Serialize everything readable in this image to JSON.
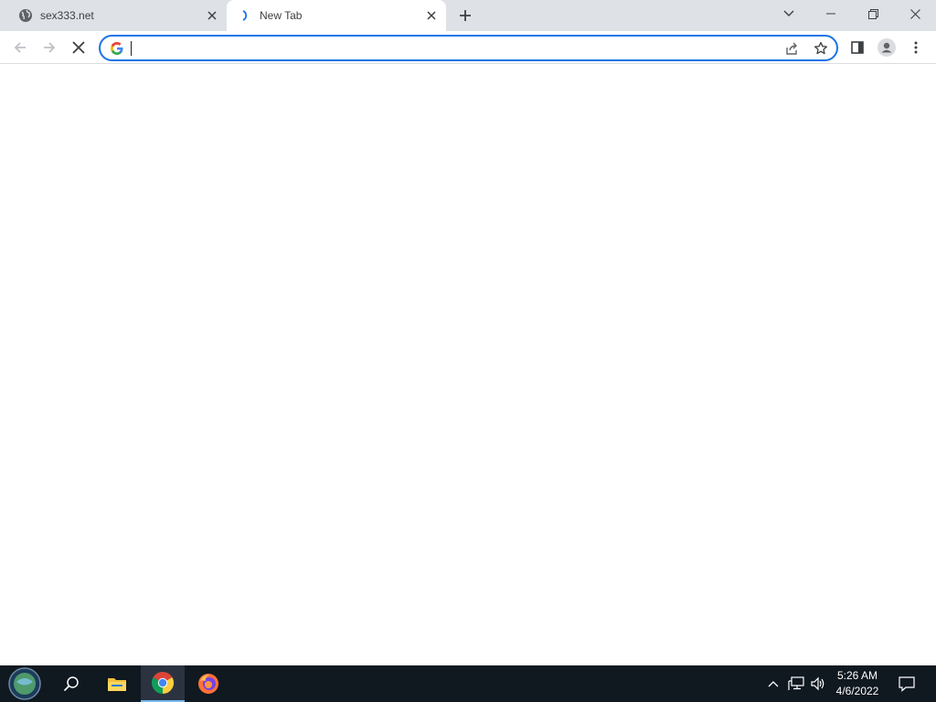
{
  "tabs": [
    {
      "title": "sex333.net",
      "favicon": "globe-icon",
      "active": false
    },
    {
      "title": "New Tab",
      "favicon": "loading-spinner-icon",
      "active": true
    }
  ],
  "toolbar": {
    "omnibox_value": "",
    "search_provider_icon": "google-g-icon"
  },
  "taskbar": {
    "apps": [
      "start-button",
      "search-icon",
      "file-explorer-icon",
      "chrome-icon",
      "firefox-icon"
    ],
    "active_app": "chrome-icon",
    "time": "5:26 AM",
    "date": "4/6/2022"
  },
  "colors": {
    "tabstrip_bg": "#dee1e6",
    "omnibox_focus": "#1a73e8",
    "taskbar_bg": "#101820"
  }
}
